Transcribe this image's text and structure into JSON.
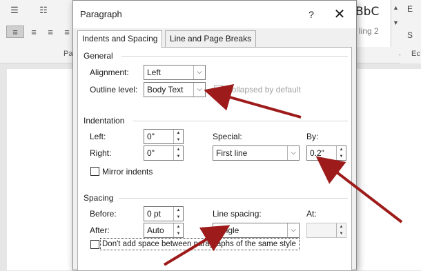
{
  "background": {
    "styles_preview": "BbC",
    "styles_subtitle": "ling 2",
    "group_label": "Pa",
    "right_glyph_top": "E",
    "right_glyph_bottom": "S",
    "right_group_label": "Ec"
  },
  "dialog": {
    "title": "Paragraph",
    "help_label": "?",
    "close_label": "✕",
    "tabs": [
      "Indents and Spacing",
      "Line and Page Breaks"
    ],
    "general": {
      "heading": "General",
      "alignment_label": "Alignment:",
      "alignment_value": "Left",
      "outline_label": "Outline level:",
      "outline_value": "Body Text",
      "collapsed_label": "Collapsed by default"
    },
    "indentation": {
      "heading": "Indentation",
      "left_label": "Left:",
      "left_value": "0\"",
      "right_label": "Right:",
      "right_value": "0\"",
      "special_label": "Special:",
      "special_value": "First line",
      "by_label": "By:",
      "by_value": "0.2\"",
      "mirror_label": "Mirror indents"
    },
    "spacing": {
      "heading": "Spacing",
      "before_label": "Before:",
      "before_value": "0 pt",
      "after_label": "After:",
      "after_value": "Auto",
      "line_spacing_label": "Line spacing:",
      "line_spacing_value": "Single",
      "at_label": "At:",
      "at_value": "",
      "dont_add_label": "Don't add space between paragraphs of the same style"
    }
  },
  "colors": {
    "arrow": "#9e1b1b",
    "dialog_bg": "#f0f0f0",
    "panel_bg": "#ffffff"
  }
}
